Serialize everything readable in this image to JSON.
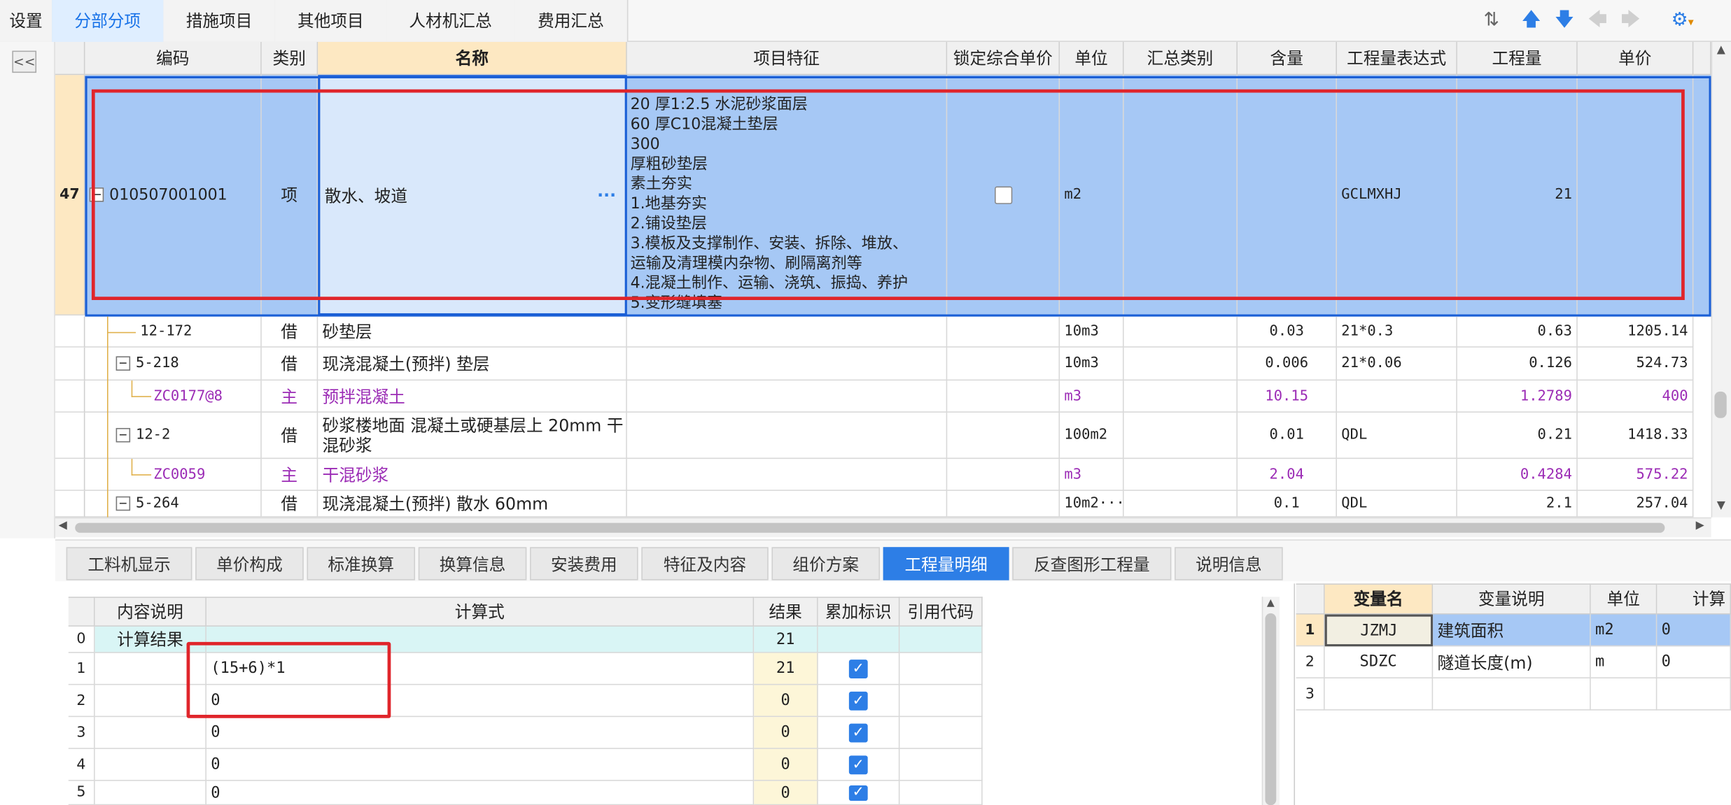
{
  "top_tabs": [
    "设置",
    "分部分项",
    "措施项目",
    "其他项目",
    "人材机汇总",
    "费用汇总"
  ],
  "toolbar_icons": [
    "sort-icon",
    "arrow-up-icon",
    "arrow-down-icon",
    "arrow-left-icon",
    "arrow-right-icon",
    "settings-icon"
  ],
  "collapse_label": "<<",
  "grid": {
    "columns": [
      "编码",
      "类别",
      "名称",
      "项目特征",
      "锁定综合单价",
      "单位",
      "汇总类别",
      "含量",
      "工程量表达式",
      "工程量",
      "单价"
    ],
    "selected_row": {
      "number": "47",
      "code": "010507001001",
      "type": "项",
      "name": "散水、坡道",
      "features": [
        "20 厚1:2.5 水泥砂浆面层",
        "60 厚C10混凝土垫层",
        "300",
        "厚粗砂垫层",
        "素土夯实",
        "1.地基夯实",
        "2.铺设垫层",
        "3.模板及支撑制作、安装、拆除、堆放、",
        "运输及清理模内杂物、刷隔离剂等",
        "4.混凝土制作、运输、浇筑、振捣、养护",
        "5.变形缝填塞"
      ],
      "unit": "m2",
      "expr": "GCLMXHJ",
      "qty": "21",
      "ellipsis": "···"
    },
    "rows": [
      {
        "code": "12-172",
        "type": "借",
        "name": "砂垫层",
        "unit": "10m3",
        "content": "0.03",
        "expr": "21*0.3",
        "qty": "0.63",
        "price": "1205.14"
      },
      {
        "code": "5-218",
        "type": "借",
        "name": "现浇混凝土(预拌) 垫层",
        "unit": "10m3",
        "content": "0.006",
        "expr": "21*0.06",
        "qty": "0.126",
        "price": "524.73"
      },
      {
        "code": "ZC0177@8",
        "type": "主",
        "name": "预拌混凝土",
        "unit": "m3",
        "content": "10.15",
        "expr": "",
        "qty": "1.2789",
        "price": "400"
      },
      {
        "code": "12-2",
        "type": "借",
        "name": "砂浆楼地面 混凝土或硬基层上 20mm 干",
        "name2": "混砂浆",
        "unit": "100m2",
        "content": "0.01",
        "expr": "QDL",
        "qty": "0.21",
        "price": "1418.33"
      },
      {
        "code": "ZC0059",
        "type": "主",
        "name": "干混砂浆",
        "unit": "m3",
        "content": "2.04",
        "expr": "",
        "qty": "0.4284",
        "price": "575.22"
      },
      {
        "code": "5-264",
        "type": "借",
        "name": "现浇混凝土(预拌) 散水 60mm",
        "unit": "10m2···",
        "content": "0.1",
        "expr": "QDL",
        "qty": "2.1",
        "price": "257.04"
      }
    ]
  },
  "bottom_tabs": [
    "工料机显示",
    "单价构成",
    "标准换算",
    "换算信息",
    "安装费用",
    "特征及内容",
    "组价方案",
    "工程量明细",
    "反查图形工程量",
    "说明信息"
  ],
  "calc": {
    "columns": [
      "内容说明",
      "计算式",
      "结果",
      "累加标识",
      "引用代码"
    ],
    "rows": [
      {
        "no": "0",
        "desc": "计算结果",
        "formula": "",
        "result": "21"
      },
      {
        "no": "1",
        "desc": "",
        "formula": "(15+6)*1",
        "result": "21"
      },
      {
        "no": "2",
        "desc": "",
        "formula": "0",
        "result": "0"
      },
      {
        "no": "3",
        "desc": "",
        "formula": "0",
        "result": "0"
      },
      {
        "no": "4",
        "desc": "",
        "formula": "0",
        "result": "0"
      },
      {
        "no": "5",
        "desc": "",
        "formula": "0",
        "result": "0"
      }
    ]
  },
  "vars": {
    "columns": [
      "变量名",
      "变量说明",
      "单位",
      "计算"
    ],
    "rows": [
      {
        "no": "1",
        "name": "JZMJ",
        "desc": "建筑面积",
        "unit": "m2",
        "val": "0"
      },
      {
        "no": "2",
        "name": "SDZC",
        "desc": "隧道长度(m)",
        "unit": "m",
        "val": "0"
      },
      {
        "no": "3",
        "name": "",
        "desc": "",
        "unit": "",
        "val": ""
      }
    ]
  },
  "colors": {
    "accent": "#2d7ee6",
    "selection": "#a6c8f5",
    "highlight_box": "#e0252b",
    "material_text": "#9b2bb5"
  }
}
